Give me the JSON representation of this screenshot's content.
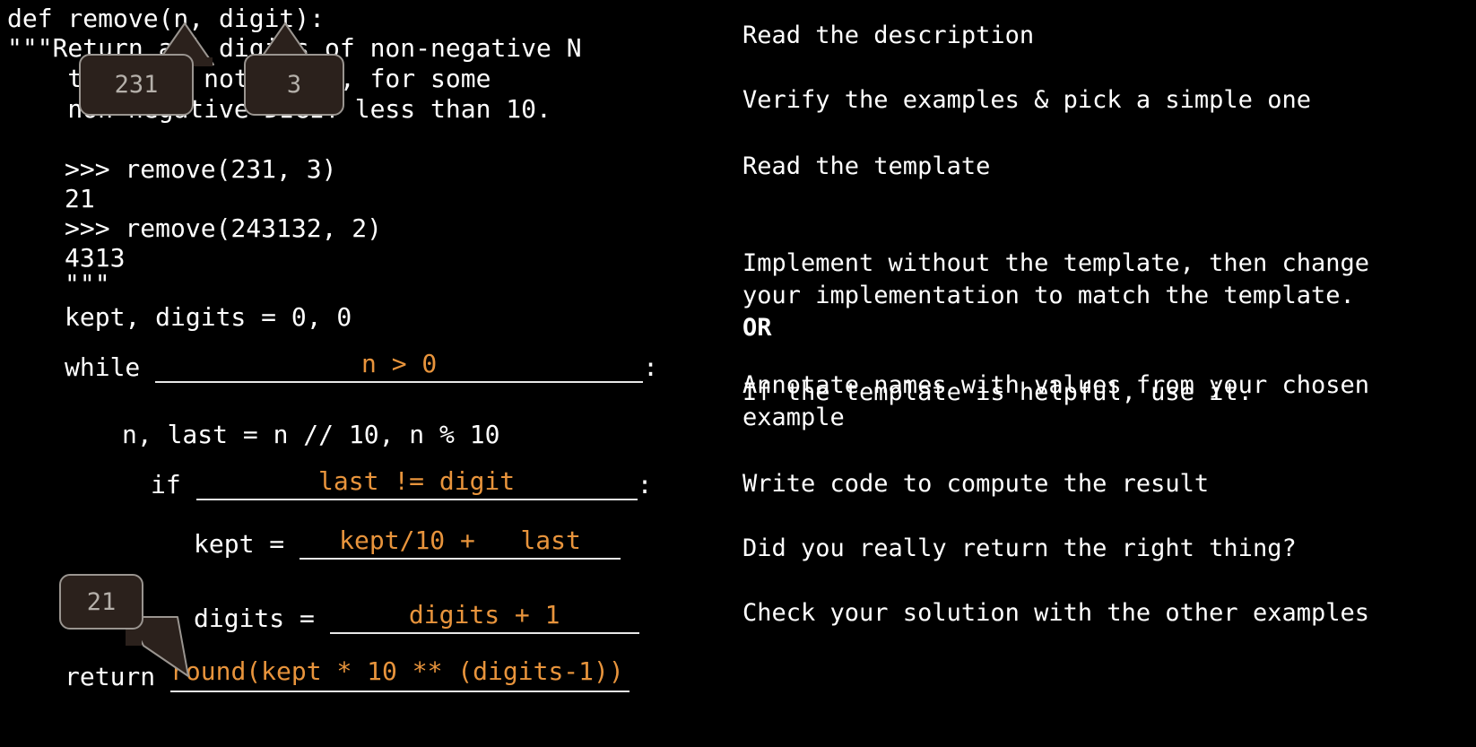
{
  "code": {
    "signature": "def remove(n, digit):",
    "docstring_open": "\"\"\"Return all digits of non-negative N",
    "docstring_line2": "    that are not DIGIT, for some",
    "docstring_line3": "    non-negative DIGIT less than 10.",
    "example1_call": ">>> remove(231, 3)",
    "example1_out": "21",
    "example2_call": ">>> remove(243132, 2)",
    "example2_out": "4313",
    "docstring_close": "\"\"\"",
    "init": "kept, digits = 0, 0",
    "while_kw": "while ",
    "while_answer": "n > 0",
    "while_colon": ":",
    "divmod_line": "n, last = n // 10, n % 10",
    "if_kw": "if ",
    "if_answer": "last != digit",
    "if_colon": ":",
    "kept_kw": "kept = ",
    "kept_answer": "kept/10 +   last",
    "digits_kw": "digits = ",
    "digits_answer": "digits + 1",
    "return_kw": "return ",
    "return_answer": "round(kept * 10 ** (digits-1))"
  },
  "annotations": [
    {
      "value": "231",
      "target": "parameter-n"
    },
    {
      "value": "3",
      "target": "parameter-digit"
    },
    {
      "value": "21",
      "target": "return-expression"
    }
  ],
  "steps": [
    {
      "text": "Read the description"
    },
    {
      "text": "Verify the examples & pick a simple one"
    },
    {
      "text": "Read the template"
    },
    {
      "text_before": "Implement without the template, then change\nyour implementation to match the template.",
      "or": "OR",
      "text_after": "If the template is helpful, use it."
    },
    {
      "text": "Annotate names with values from your chosen\nexample"
    },
    {
      "text": "Write code to compute the result"
    },
    {
      "text": "Did you really return the right thing?"
    },
    {
      "text": "Check your solution with the other examples"
    }
  ],
  "colors": {
    "background": "#000000",
    "code_text": "#ffffff",
    "answer_orange": "#e8943c",
    "bubble_fill": "#2b211c",
    "bubble_border": "#9a9590",
    "bubble_text": "#b5b0aa",
    "rule": "#e8e8e8"
  }
}
